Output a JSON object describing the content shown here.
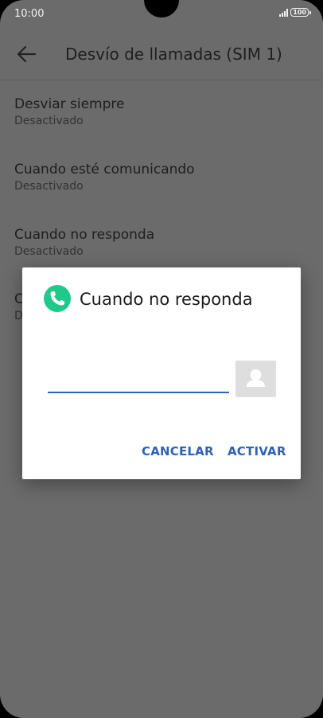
{
  "status_bar": {
    "time": "10:00",
    "battery": "100"
  },
  "app_bar": {
    "title": "Desvío de llamadas (SIM 1)"
  },
  "settings": [
    {
      "title": "Desviar siempre",
      "subtitle": "Desactivado"
    },
    {
      "title": "Cuando esté comunicando",
      "subtitle": "Desactivado"
    },
    {
      "title": "Cuando no responda",
      "subtitle": "Desactivado"
    },
    {
      "title": "C",
      "subtitle": "D"
    }
  ],
  "dialog": {
    "title": "Cuando no responda",
    "number_value": "",
    "cancel_label": "CANCELAR",
    "activate_label": "ACTIVAR"
  },
  "colors": {
    "accent": "#2d62b5",
    "phone_icon": "#1ec98a",
    "scrim": "#6b6b6b"
  },
  "icons": [
    "back-arrow-icon",
    "phone-icon",
    "contact-icon",
    "signal-icon",
    "battery-icon"
  ]
}
